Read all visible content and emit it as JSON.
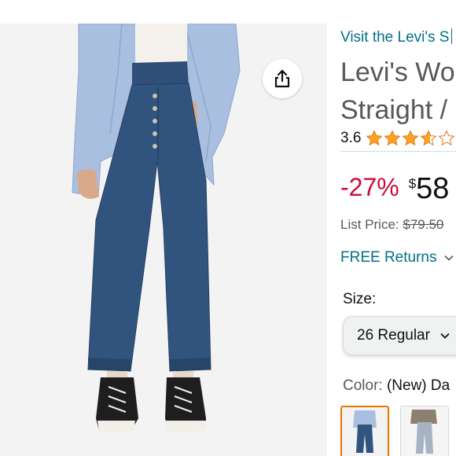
{
  "detail": {
    "brand_link": "Visit the Levi's S",
    "title_line1": "Levi's Wo",
    "title_line2": "Straight /",
    "rating": {
      "value": "3.6",
      "stars": 3.6,
      "star_color": "#ffa41c"
    },
    "discount": "-27%",
    "currency": "$",
    "price_whole": "58",
    "list_price_label": "List Price:",
    "list_price_value": "$79.50",
    "returns_label": "FREE Returns",
    "size_label": "Size:",
    "size_value": "26 Regular",
    "color_label": "Color:",
    "color_value": "(New) Da"
  },
  "colors": {
    "link": "#007185",
    "discount": "#cc0c39",
    "selected_border": "#e77600"
  }
}
